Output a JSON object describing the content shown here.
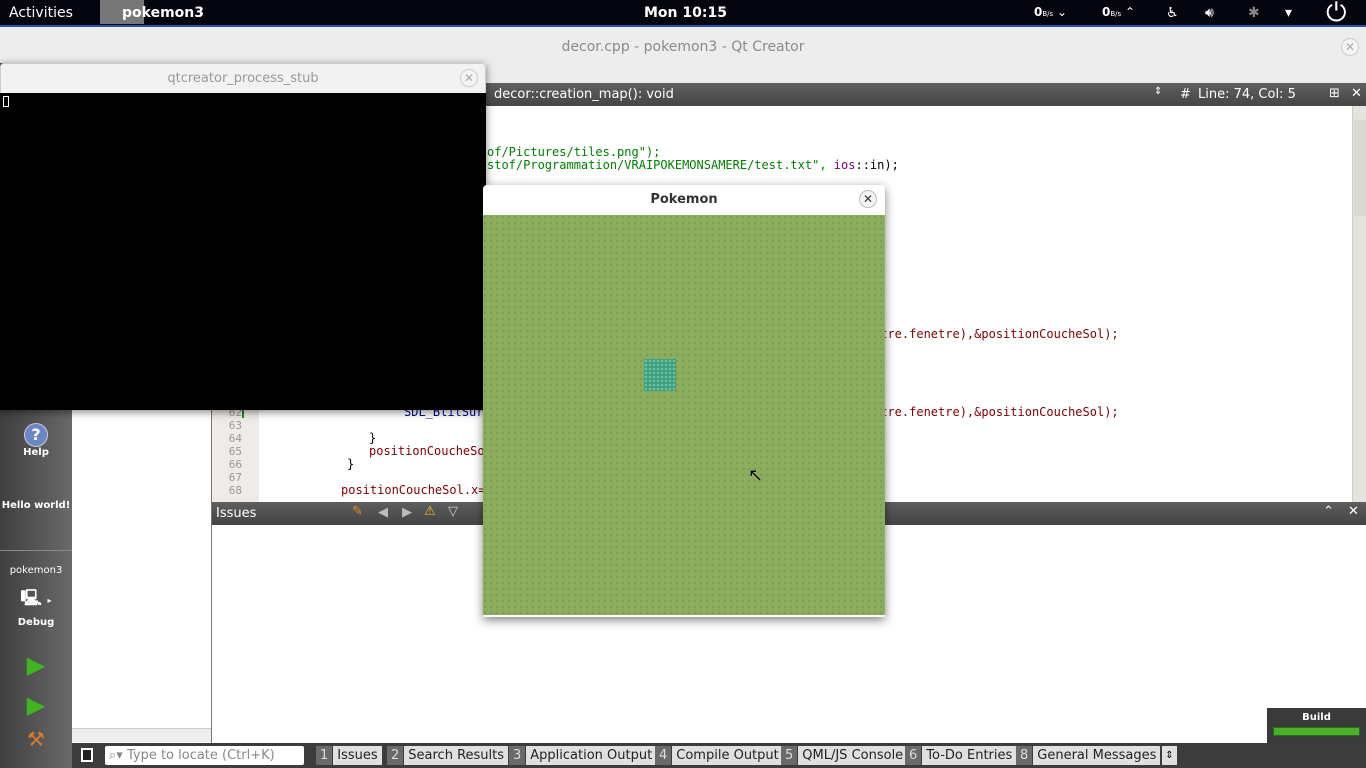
{
  "topbar": {
    "activities": "Activities",
    "app": "pokemon3",
    "clock": "Mon 10:15",
    "net_down": "0",
    "net_down_unit": "B/s",
    "net_up": "0",
    "net_up_unit": "B/s"
  },
  "window_title": "decor.cpp - pokemon3 - Qt Creator",
  "editor_toolbar": {
    "symbol": "decor::creation_map(): void",
    "hash": "#",
    "position": "Line: 74, Col: 5"
  },
  "code": {
    "frag_42": "of/Pictures/tiles.png\");",
    "frag_43a": "stof/Programmation/VRAIPOKEMONSAMERE/test.txt\", ",
    "frag_43b": "ios",
    "frag_43c": "::in);",
    "frag_56": "etre.fenetre),&positionCoucheSol);",
    "frag_62a": "SDL_BlitSur",
    "frag_62b": "etre.fenetre),&positionCoucheSol);",
    "l64": "}",
    "l65": "positionCoucheSol",
    "l66": "}",
    "l68": "positionCoucheSol.x=",
    "line_numbers": [
      "62",
      "63",
      "64",
      "65",
      "66",
      "67",
      "68"
    ]
  },
  "modebar": {
    "help": "Help",
    "hello": "Hello world!",
    "project": "pokemon3",
    "target": "Debug"
  },
  "issues": {
    "title": "Issues"
  },
  "statusbar": {
    "locate_placeholder": "Type to locate (Ctrl+K)",
    "tabs": [
      {
        "n": "1",
        "label": "Issues"
      },
      {
        "n": "2",
        "label": "Search Results"
      },
      {
        "n": "3",
        "label": "Application Output"
      },
      {
        "n": "4",
        "label": "Compile Output"
      },
      {
        "n": "5",
        "label": "QML/JS Console"
      },
      {
        "n": "6",
        "label": "To-Do Entries"
      },
      {
        "n": "8",
        "label": "General Messages"
      }
    ]
  },
  "build": {
    "label": "Build",
    "progress": 100,
    "color": "#4caf2a"
  },
  "stub": {
    "title": "qtcreator_process_stub"
  },
  "pokemon": {
    "title": "Pokemon",
    "grass_color": "#8cad5e",
    "tile_color": "#3e9e80"
  }
}
